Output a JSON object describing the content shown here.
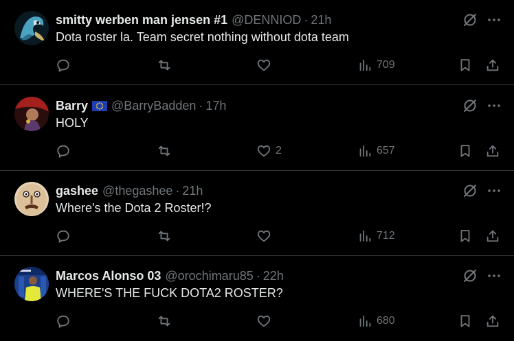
{
  "tweets": [
    {
      "name": "smitty werben man jensen #1",
      "handle": "@DENNIOD",
      "time": "21h",
      "text": "Dota roster la. Team secret nothing without dota team",
      "likes": "",
      "views": "709",
      "avatar": "avatar-dragon"
    },
    {
      "name": "Barry",
      "flag": "eu-flag-icon",
      "handle": "@BarryBadden",
      "time": "17h",
      "text": "HOLY",
      "likes": "2",
      "views": "657",
      "avatar": "avatar-person-red"
    },
    {
      "name": "gashee",
      "handle": "@thegashee",
      "time": "21h",
      "text": "Where's the Dota 2 Roster!?",
      "likes": "",
      "views": "712",
      "avatar": "avatar-cartoon-face"
    },
    {
      "name": "Marcos Alonso 03",
      "handle": "@orochimaru85",
      "time": "22h",
      "text": "WHERE'S THE FUCK DOTA2 ROSTER?",
      "likes": "",
      "views": "680",
      "avatar": "avatar-football-player"
    }
  ],
  "separator": "·",
  "colors": {
    "background": "#000000",
    "text_primary": "#e7e9ea",
    "text_secondary": "#71767b",
    "divider": "#2f3336"
  }
}
